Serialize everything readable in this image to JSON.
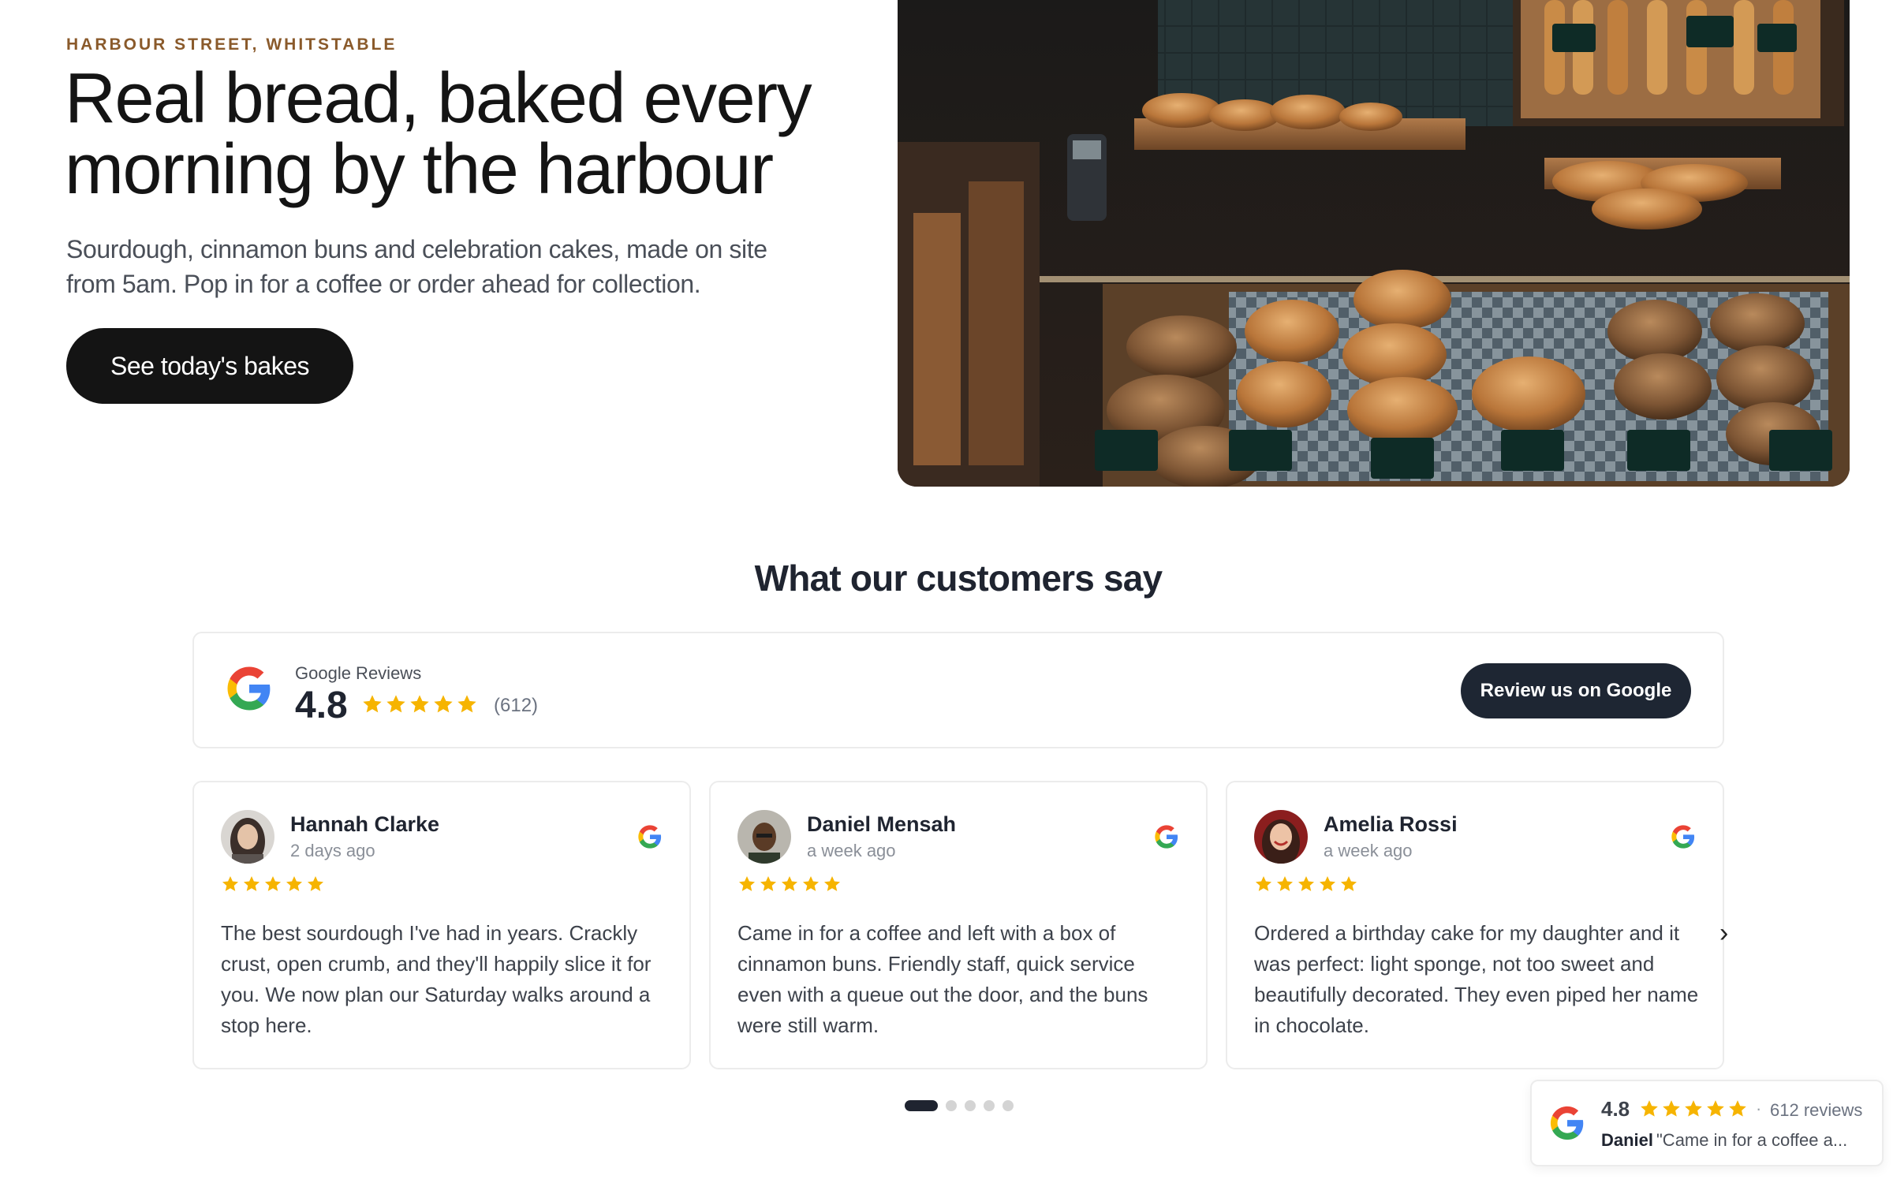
{
  "hero": {
    "eyebrow": "HARBOUR STREET, WHITSTABLE",
    "title_line1": "Real bread, baked every",
    "title_line2": "morning by the harbour",
    "subtitle": "Sourdough, cinnamon buns and celebration cakes, made on site from 5am. Pop in for a coffee or order ahead for collection.",
    "cta_label": "See today's bakes",
    "image_alt": "Bakery display counter with loaves of bread"
  },
  "reviews": {
    "heading": "What our customers say",
    "summary": {
      "source_label": "Google Reviews",
      "rating": "4.8",
      "count": "(612)",
      "button_label": "Review us on Google"
    },
    "cards": [
      {
        "name": "Hannah Clarke",
        "time": "2 days ago",
        "text": "The best sourdough I've had in years. Crackly crust, open crumb, and they'll happily slice it for you. We now plan our Saturday walks around a stop here."
      },
      {
        "name": "Daniel Mensah",
        "time": "a week ago",
        "text": "Came in for a coffee and left with a box of cinnamon buns. Friendly staff, quick service even with a queue out the door, and the buns were still warm."
      },
      {
        "name": "Amelia Rossi",
        "time": "a week ago",
        "text": "Ordered a birthday cake for my daughter and it was perfect: light sponge, not too sweet and beautifully decorated. They even piped her name in chocolate."
      }
    ],
    "next_arrow": "›",
    "pagination": {
      "pages": 5,
      "current": 1
    }
  },
  "badge": {
    "rating": "4.8",
    "separator": "·",
    "count": "612 reviews",
    "reviewer": "Daniel",
    "quote": "\"Came in for a coffee a..."
  },
  "colors": {
    "star": "#f6b400",
    "dark_button": "#141414",
    "review_button": "#1e2633",
    "eyebrow": "#8a5a2b",
    "google_blue": "#4285f4",
    "google_red": "#ea4335",
    "google_yellow": "#fbbc05",
    "google_green": "#34a853"
  },
  "icons": {
    "logo": "google-g-icon",
    "star": "star-icon",
    "next": "chevron-right-icon"
  }
}
